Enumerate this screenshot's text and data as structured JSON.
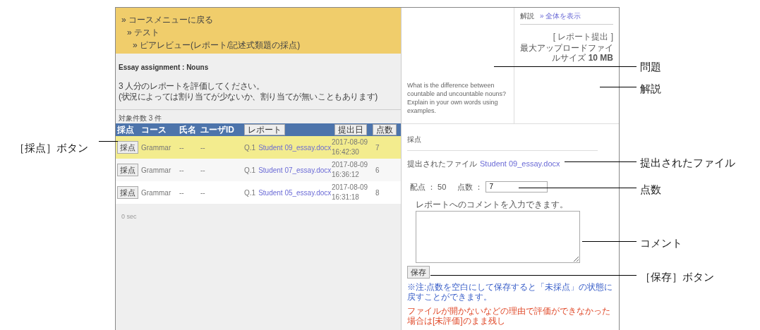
{
  "breadcrumbs": [
    {
      "label": "» コースメニューに戻る",
      "children": [
        {
          "label": "» テスト",
          "children": [
            {
              "label": "» ピアレビュー(レポート/記述式類題の採点)"
            }
          ]
        }
      ]
    }
  ],
  "assignment_title": "Essay assignment : Nouns",
  "instructions": [
    "3 人分のレポートを評価してください。",
    "(状況によっては割り当てが少ないか、割り当てが無いこともあります)"
  ],
  "count": "対象件数 3 件",
  "table": {
    "columns": [
      {
        "label": "採点",
        "kind": "text"
      },
      {
        "label": "コース",
        "kind": "text"
      },
      {
        "label": "氏名",
        "kind": "text"
      },
      {
        "label": "ユーザID",
        "kind": "text"
      },
      {
        "label": "レポート",
        "kind": "button"
      },
      {
        "label": "提出日",
        "kind": "button"
      },
      {
        "label": "点数",
        "kind": "button"
      }
    ],
    "rows": [
      {
        "button": "採点",
        "course": "Grammar",
        "name": "--",
        "user_id": "--",
        "question": "Q.1",
        "file": "Student 09_essay.docx",
        "date": "2017-08-09",
        "time": "16:42:30",
        "score": "7",
        "selected": true
      },
      {
        "button": "採点",
        "course": "Grammar",
        "name": "--",
        "user_id": "--",
        "question": "Q.1",
        "file": "Student 07_essay.docx",
        "date": "2017-08-09",
        "time": "16:36:12",
        "score": "6",
        "selected": false
      },
      {
        "button": "採点",
        "course": "Grammar",
        "name": "--",
        "user_id": "--",
        "question": "Q.1",
        "file": "Student 05_essay.docx",
        "date": "2017-08-09",
        "time": "16:31:18",
        "score": "8",
        "selected": false
      }
    ]
  },
  "timing": "0 sec",
  "question": {
    "lines": [
      "What is the difference between countable and uncountable nouns?",
      "Explain in your own words using examples."
    ]
  },
  "explanation": {
    "tab": "解説",
    "link": "» 全体を表示",
    "heading": "[ レポート提出 ]",
    "max_size": "最大アップロードファイルサイズ **10 MB**"
  },
  "grading": {
    "title": "採点",
    "file_label": "提出されたファイル",
    "file_link": "Student 09_essay.docx",
    "full_marks": "配点 ： 50",
    "score_label": "点数 ：",
    "score_value": "7",
    "comment_label": "レポートへのコメントを入力できます。",
    "save": "保存",
    "note": "※注:点数を空白にして保存すると「未採点」の状態に戻すことができます。",
    "warning": "ファイルが開かないなどの理由で評価ができなかった場合は[未評価]のまま残し"
  },
  "callouts": [
    {
      "label": "［採点］ボタン"
    },
    {
      "label": "問題"
    },
    {
      "label": "解説"
    },
    {
      "label": "提出されたファイル"
    },
    {
      "label": "点数"
    },
    {
      "label": "コメント"
    },
    {
      "label": "［保存］ボタン"
    }
  ]
}
